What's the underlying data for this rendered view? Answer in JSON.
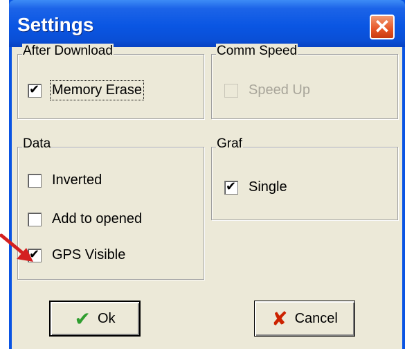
{
  "window": {
    "title": "Settings",
    "close_icon": "close-icon"
  },
  "groups": {
    "after_download": {
      "label": "After Download",
      "items": [
        {
          "label": "Memory Erase",
          "checked": true,
          "enabled": true
        }
      ]
    },
    "comm_speed": {
      "label": "Comm Speed",
      "items": [
        {
          "label": "Speed Up",
          "checked": false,
          "enabled": false
        }
      ]
    },
    "data": {
      "label": "Data",
      "items": [
        {
          "label": "Inverted",
          "checked": false,
          "enabled": true
        },
        {
          "label": "Add to opened",
          "checked": false,
          "enabled": true
        },
        {
          "label": "GPS Visible",
          "checked": true,
          "enabled": true
        }
      ]
    },
    "graf": {
      "label": "Graf",
      "items": [
        {
          "label": "Single",
          "checked": true,
          "enabled": true
        }
      ]
    }
  },
  "buttons": {
    "ok": {
      "label": "Ok",
      "icon": "green-checkmark-icon",
      "icon_color": "#2f9e2f"
    },
    "cancel": {
      "label": "Cancel",
      "icon": "red-x-icon",
      "icon_color": "#cc2200"
    }
  },
  "annotation": {
    "icon": "red-arrow-icon",
    "color": "#d42020"
  }
}
